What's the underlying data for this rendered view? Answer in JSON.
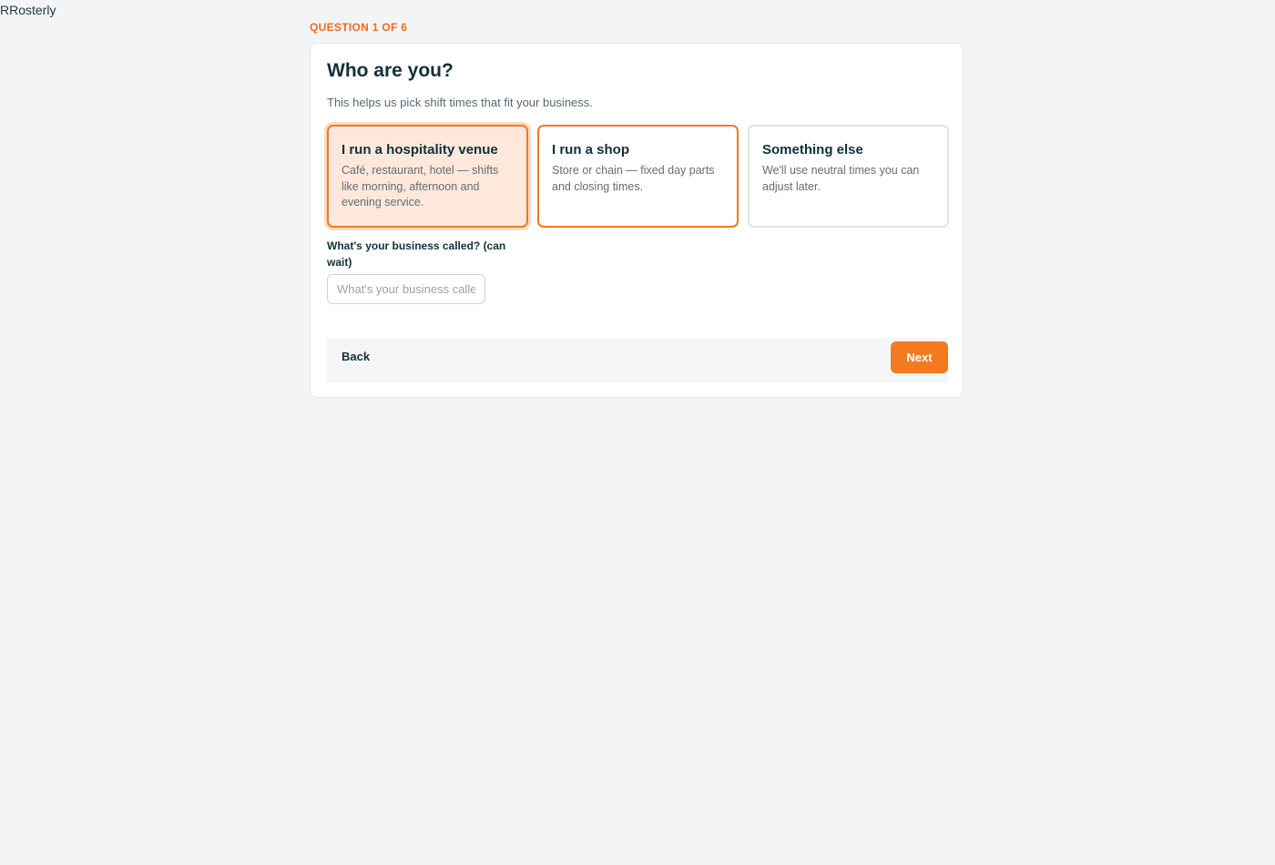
{
  "app": {
    "brand": "RRosterly"
  },
  "progress": {
    "label": "QUESTION 1 OF 6"
  },
  "question": {
    "title": "Who are you?",
    "subtitle": "This helps us pick shift times that fit your business."
  },
  "options": [
    {
      "title": "I run a hospitality venue",
      "description": "Café, restaurant, hotel — shifts like morning, afternoon and evening service.",
      "selected": true
    },
    {
      "title": "I run a shop",
      "description": "Store or chain — fixed day parts and closing times.",
      "selected": false
    },
    {
      "title": "Something else",
      "description": "We'll use neutral times you can adjust later.",
      "selected": false
    }
  ],
  "business_name": {
    "label": "What's your business called? (can wait)",
    "placeholder": "What's your business called?",
    "value": ""
  },
  "footer": {
    "back_label": "Back",
    "next_label": "Next"
  },
  "colors": {
    "accent": "#f47a1f",
    "selected_background": "#fde8db",
    "page_background": "#f3f4f6"
  }
}
